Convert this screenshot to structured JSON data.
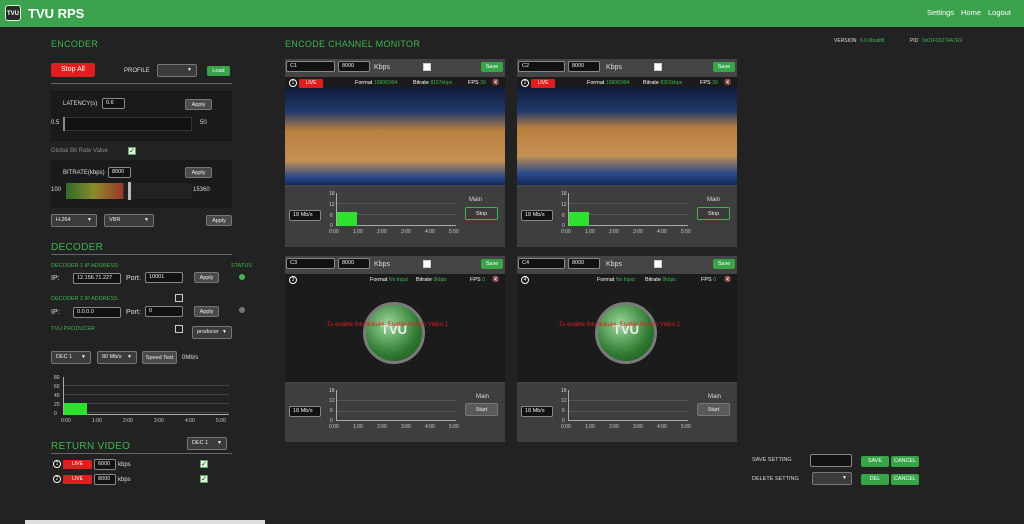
{
  "app": {
    "title": "TVU RPS",
    "logo_text": "TVU"
  },
  "nav": [
    "Settings",
    "Home",
    "Logout"
  ],
  "encoder": {
    "title": "ENCODER",
    "stop_all": "Stop All",
    "profile_label": "PROFILE",
    "load": "Load",
    "latency_label": "LATENCY(s)",
    "latency_value": "0.6",
    "apply": "Apply",
    "latency_min": "0.5",
    "latency_max": "50",
    "global_bitrate_label": "Global Bit Rate Value",
    "bitrate_label": "BITRATE(kbps)",
    "bitrate_value": "8000",
    "bitrate_min": "100",
    "bitrate_max": "15360",
    "codec": "H.264",
    "rate_mode": "VBR"
  },
  "decoder": {
    "title": "DECODER",
    "status_label": "STATUS",
    "d1_label": "DECODER 1 IP ADDRESS:",
    "ip_label": "IP:",
    "d1_ip": "12.156.71.227",
    "port_label": "Port:",
    "d1_port": "10001",
    "d2_label": "DECODER 2 IP ADDRESS:",
    "d2_ip": "0.0.0.0",
    "d2_port": "0",
    "producer_label": "TVU PRODUCER",
    "producer_select": "producer",
    "dec_select": "DEC 1",
    "speed_select": "80 Mb/s",
    "speed_test": "Speed Test",
    "speed_result": "0Mb/s",
    "chart_y": [
      "80",
      "60",
      "40",
      "20",
      "0"
    ],
    "chart_x": [
      "0:00",
      "1:00",
      "2:00",
      "3:00",
      "4:00",
      "5:00"
    ]
  },
  "return_video": {
    "title": "RETURN VIDEO",
    "dec_select": "DEC 1",
    "rows": [
      {
        "num": "1",
        "live": "LIVE",
        "kbps_value": "6000",
        "unit": "kbps"
      },
      {
        "num": "2",
        "live": "LIVE",
        "kbps_value": "8000",
        "unit": "kbps"
      }
    ]
  },
  "monitor": {
    "title": "ENCODE CHANNEL MONITOR",
    "version_label": "VERSION",
    "version_value": "6.0.0build8",
    "pid_label": "PID",
    "pid_value": "0x01F03274A7E9",
    "channels": [
      {
        "name": "C1",
        "bitrate": "8000",
        "kbps": "Kbps",
        "save": "Save",
        "num": "1",
        "live": "LIVE",
        "format_label": "Format",
        "format_value": "1080i5994",
        "bitrate_label": "Bitrate",
        "bitrate_value": "8157kbps",
        "fps_label": "FPS",
        "fps_value": "30",
        "speed": "18 Mb/s",
        "main": "Main",
        "action": "Stop"
      },
      {
        "name": "C2",
        "bitrate": "8000",
        "kbps": "Kbps",
        "save": "Save",
        "num": "2",
        "live": "LIVE",
        "format_label": "Format",
        "format_value": "1080i5994",
        "bitrate_label": "Bitrate",
        "bitrate_value": "8301kbps",
        "fps_label": "FPS",
        "fps_value": "30",
        "speed": "18 Mb/s",
        "main": "Main",
        "action": "Stop"
      },
      {
        "name": "C3",
        "bitrate": "8000",
        "kbps": "Kbps",
        "save": "Save",
        "num": "3",
        "format_label": "Format",
        "format_value": "No Input",
        "bitrate_label": "Bitrate",
        "bitrate_value": "0kbps",
        "fps_label": "FPS",
        "fps_value": "0",
        "message": "To enable this feature, Enable Return Video 1",
        "speed": "18 Mb/s",
        "main": "Main",
        "action": "Start"
      },
      {
        "name": "C4",
        "bitrate": "8000",
        "kbps": "Kbps",
        "save": "Save",
        "num": "4",
        "format_label": "Format",
        "format_value": "No Input",
        "bitrate_label": "Bitrate",
        "bitrate_value": "0kbps",
        "fps_label": "FPS",
        "fps_value": "0",
        "message": "To enable this feature, Enable Return Video 2",
        "speed": "18 Mb/s",
        "main": "Main",
        "action": "Start"
      }
    ],
    "chart_y": [
      "18",
      "12",
      "6",
      "0"
    ],
    "chart_x": [
      "0:00",
      "1:00",
      "2:00",
      "3:00",
      "4:00",
      "5:00"
    ]
  },
  "settings": {
    "save_label": "SAVE SETTING",
    "delete_label": "DELETE SETTING",
    "save": "SAVE",
    "cancel": "CANCEL",
    "del": "DEL"
  },
  "colors": {
    "accent": "#3da24d",
    "live": "#e01e1e",
    "bg": "#222222"
  }
}
